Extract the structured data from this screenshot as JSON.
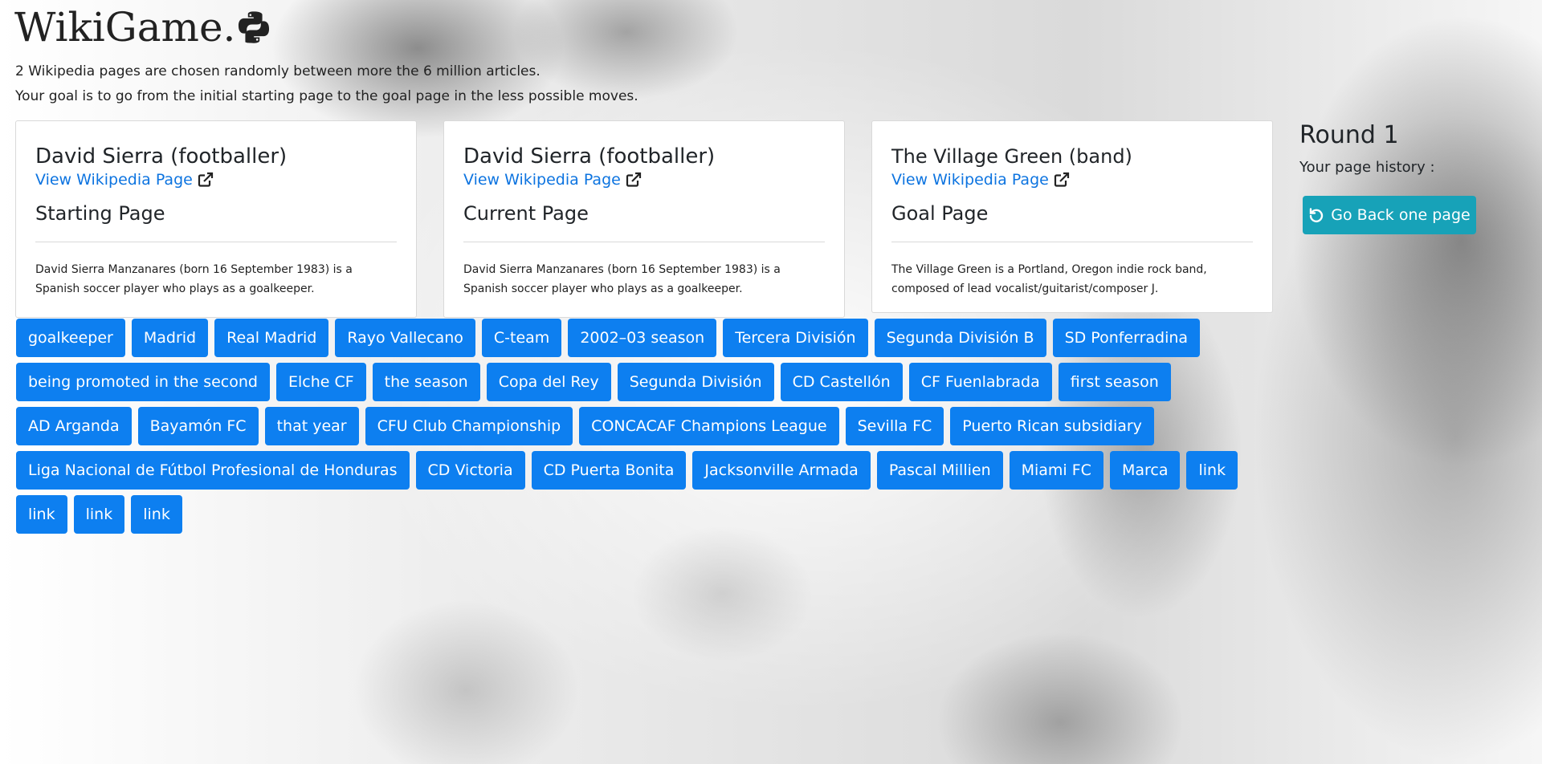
{
  "app": {
    "logo_text": "WikiGame.",
    "intro_line1": "2 Wikipedia pages are chosen randomly between more the 6 million articles.",
    "intro_line2": "Your goal is to go from the initial starting page to the goal page in the less possible moves."
  },
  "cards": {
    "starting": {
      "title": "David Sierra (footballer)",
      "link_label": "View Wikipedia Page",
      "role": "Starting Page",
      "summary": "David Sierra Manzanares (born 16 September 1983) is a Spanish soccer player who plays as a goalkeeper."
    },
    "current": {
      "title": "David Sierra (footballer)",
      "link_label": "View Wikipedia Page",
      "role": "Current Page",
      "summary": "David Sierra Manzanares (born 16 September 1983) is a Spanish soccer player who plays as a goalkeeper."
    },
    "goal": {
      "title": "The Village Green (band)",
      "link_label": "View Wikipedia Page",
      "role": "Goal Page",
      "summary": "The Village Green is a Portland, Oregon indie rock band, composed of lead vocalist/guitarist/composer J."
    }
  },
  "side": {
    "round_label": "Round 1",
    "history_label": "Your page history :",
    "back_button_label": "Go Back one page"
  },
  "links": [
    "goalkeeper",
    "Madrid",
    "Real Madrid",
    "Rayo Vallecano",
    "C-team",
    "2002–03 season",
    "Tercera División",
    "Segunda División B",
    "SD Ponferradina",
    "being promoted in the second",
    "Elche CF",
    "the season",
    "Copa del Rey",
    "Segunda División",
    "CD Castellón",
    "CF Fuenlabrada",
    "first season",
    "AD Arganda",
    "Bayamón FC",
    "that year",
    "CFU Club Championship",
    "CONCACAF Champions League",
    "Sevilla FC",
    "Puerto Rican subsidiary",
    "Liga Nacional de Fútbol Profesional de Honduras",
    "CD Victoria",
    "CD Puerta Bonita",
    "Jacksonville Armada",
    "Pascal Millien",
    "Miami FC",
    "Marca",
    "link",
    "link",
    "link",
    "link"
  ],
  "icons": {
    "logo_icon": "python-logo-icon",
    "external_link_icon": "external-link-icon",
    "undo_icon": "undo-icon"
  },
  "colors": {
    "primary": "#0d7ff0",
    "info": "#17a2b8",
    "link_text": "#0d74e0"
  }
}
